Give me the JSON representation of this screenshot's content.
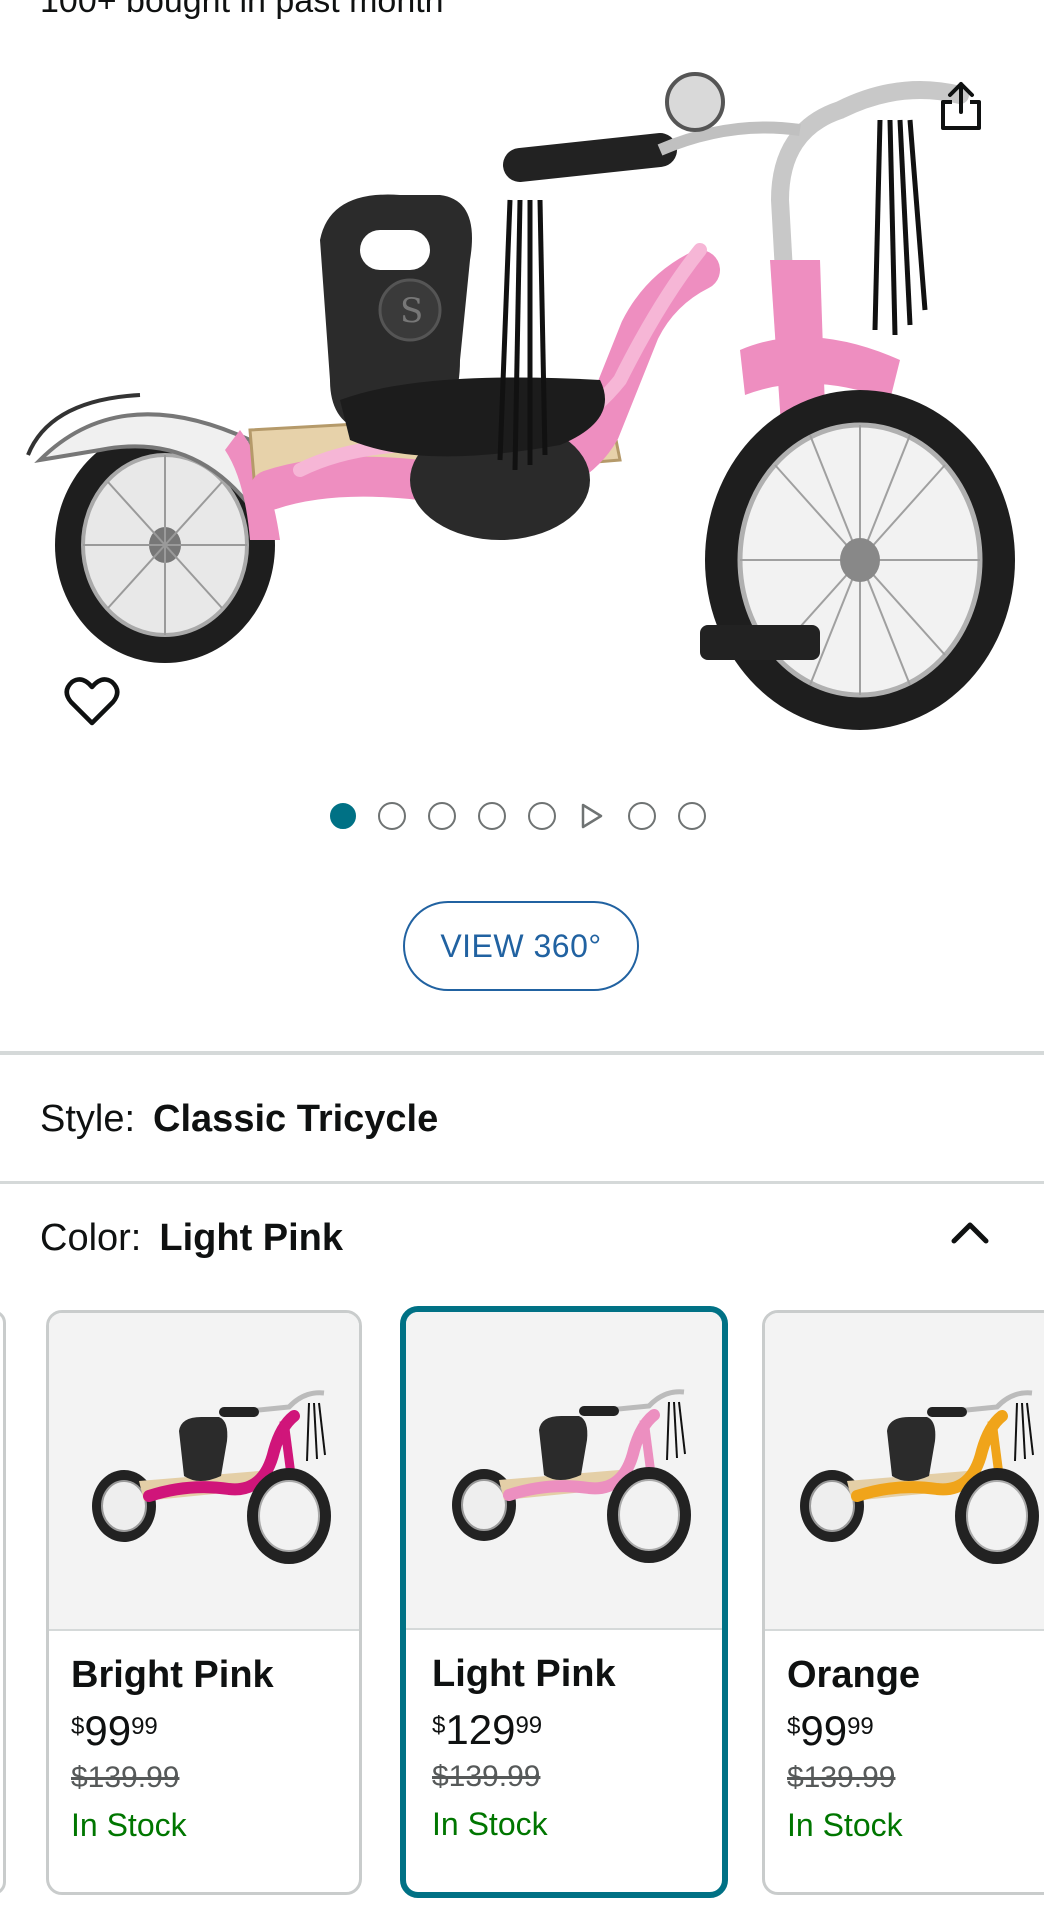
{
  "header": {
    "bought_text": "100+ bought in past month"
  },
  "gallery": {
    "dot_count": 8,
    "active_index": 0,
    "video_index": 5,
    "view360_label": "VIEW 360°"
  },
  "icons": {
    "share": "share-icon",
    "wishlist": "heart-outline-icon",
    "collapse": "chevron-up-icon"
  },
  "style_row": {
    "label": "Style:",
    "value": "Classic Tricycle"
  },
  "color_row": {
    "label": "Color:",
    "value": "Light Pink"
  },
  "swatches": [
    {
      "name": "Bright Pink",
      "currency": "$",
      "whole": "99",
      "fraction": "99",
      "list_price": "$139.99",
      "availability": "In Stock",
      "frame_color": "#d0157a",
      "selected": false
    },
    {
      "name": "Light Pink",
      "currency": "$",
      "whole": "129",
      "fraction": "99",
      "list_price": "$139.99",
      "availability": "In Stock",
      "frame_color": "#ec8fc0",
      "selected": true
    },
    {
      "name": "Orange",
      "currency": "$",
      "whole": "99",
      "fraction": "99",
      "list_price": "$139.99",
      "availability": "In Stock",
      "frame_color": "#f0a41a",
      "selected": false
    }
  ],
  "colors": {
    "accent_teal": "#007185",
    "link_blue": "#2162a1",
    "in_stock_green": "#007600",
    "hero_frame_pink": "#ee8ec0"
  }
}
